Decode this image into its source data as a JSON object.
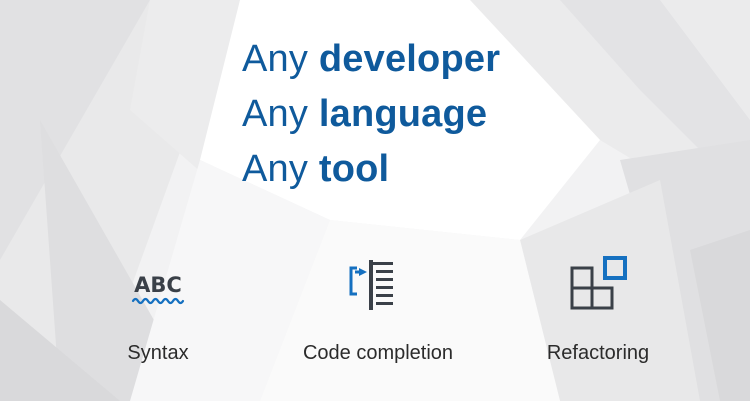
{
  "headline": {
    "lines": [
      {
        "lead": "Any",
        "strong": "developer"
      },
      {
        "lead": "Any",
        "strong": "language"
      },
      {
        "lead": "Any",
        "strong": "tool"
      }
    ]
  },
  "features": [
    {
      "label": "Syntax",
      "icon": "abc-squiggle-icon",
      "icon_text": "ABC"
    },
    {
      "label": "Code completion",
      "icon": "code-completion-icon"
    },
    {
      "label": "Refactoring",
      "icon": "refactoring-grid-icon"
    }
  ],
  "colors": {
    "headline": "#0f5a9c",
    "icon_dark": "#3a4048",
    "icon_accent": "#1570c0",
    "label": "#2b2b2b",
    "background": "#f2f2f3"
  }
}
